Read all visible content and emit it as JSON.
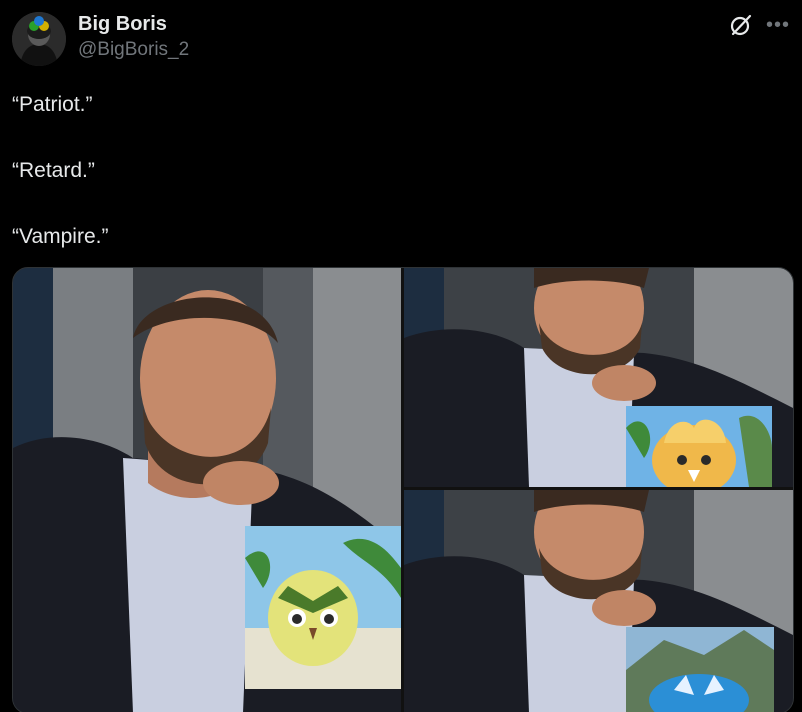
{
  "author": {
    "display_name": "Big Boris",
    "handle": "@BigBoris_2"
  },
  "icons": {
    "grok": "grok-icon",
    "more": "more-options-icon"
  },
  "tweet": {
    "lines": [
      "“Patriot.”",
      "“Retard.”",
      "“Vampire.”"
    ]
  },
  "media": {
    "panels": [
      {
        "desc": "man-with-yellow-bird-pokemon"
      },
      {
        "desc": "man-with-orange-fluffy-pokemon"
      },
      {
        "desc": "man-with-blue-pokemon"
      }
    ]
  },
  "colors": {
    "background": "#000000",
    "text": "#e7e9ea",
    "secondary": "#71767b",
    "border": "#2f3336"
  }
}
